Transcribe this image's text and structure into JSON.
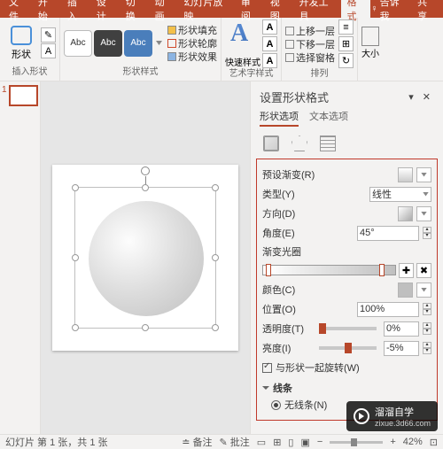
{
  "titlebar": {
    "tabs": [
      "文件",
      "开始",
      "插入",
      "设计",
      "切换",
      "动画",
      "幻灯片放映",
      "审阅",
      "视图",
      "开发工具",
      "格式"
    ],
    "active_tab": "格式",
    "tell_me": "告诉我",
    "share": "共享"
  },
  "ribbon": {
    "insert_shapes": {
      "label": "形状",
      "caption": "插入形状"
    },
    "shape_styles": {
      "swatches": [
        "Abc",
        "Abc",
        "Abc"
      ],
      "fill": "形状填充",
      "outline": "形状轮廓",
      "effects": "形状效果",
      "caption": "形状样式"
    },
    "wordart": {
      "label": "快速样式",
      "caption": "艺术字样式"
    },
    "arrange": {
      "bring_forward": "上移一层",
      "send_backward": "下移一层",
      "selection_pane": "选择窗格",
      "caption": "排列"
    },
    "size": {
      "label": "大小",
      "caption": ""
    }
  },
  "thumbs": {
    "current": "1"
  },
  "panel": {
    "title": "设置形状格式",
    "tabs": [
      "形状选项",
      "文本选项"
    ],
    "active_tab": "形状选项",
    "fill": {
      "preset": "预设渐变(R)",
      "type_label": "类型(Y)",
      "type_value": "线性",
      "direction": "方向(D)",
      "angle_label": "角度(E)",
      "angle_value": "45°",
      "stops_label": "渐变光圈",
      "color_label": "颜色(C)",
      "position_label": "位置(O)",
      "position_value": "100%",
      "transparency_label": "透明度(T)",
      "transparency_value": "0%",
      "brightness_label": "亮度(I)",
      "brightness_value": "-5%",
      "rotate_with_shape": "与形状一起旋转(W)"
    },
    "line": {
      "section": "线条",
      "no_line": "无线条(N)"
    }
  },
  "status": {
    "slide_info": "幻灯片 第 1 张，共 1 张",
    "notes": "备注",
    "comments": "批注",
    "zoom": "42%"
  },
  "watermark": {
    "brand": "溜溜自学",
    "url": "zixue.3d66.com"
  }
}
